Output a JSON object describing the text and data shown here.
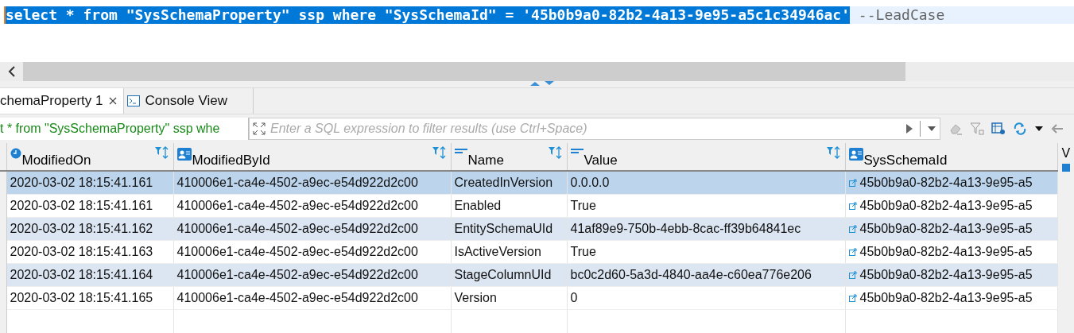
{
  "editor": {
    "segments": [
      {
        "kind": "code",
        "text": "select * from \"SysSchemaProperty\" ssp where \"SysSchemaId\" = '45b0b9a0-82b2-4a13-9e95-a5c1c34946ac'",
        "selected": true
      },
      {
        "kind": "comment",
        "text": " --LeadCase",
        "selected": false
      }
    ]
  },
  "tabs": [
    {
      "kind": "results",
      "label": "chemaProperty 1",
      "selected": true
    },
    {
      "kind": "console",
      "label": "Console View",
      "selected": false
    }
  ],
  "filter": {
    "query": "t * from \"SysSchemaProperty\" ssp whe",
    "placeholder": "Enter a SQL expression to filter results (use Ctrl+Space)"
  },
  "table": {
    "columns": [
      {
        "kind": "date",
        "label": "ModifiedOn"
      },
      {
        "kind": "ref",
        "label": "ModifiedById"
      },
      {
        "kind": "text",
        "label": "Name"
      },
      {
        "kind": "text",
        "label": "Value"
      },
      {
        "kind": "ref",
        "label": "SysSchemaId"
      }
    ],
    "rows": [
      {
        "selected": true,
        "cells": [
          "2020-03-02 18:15:41.161",
          "410006e1-ca4e-4502-a9ec-e54d922d2c00",
          "CreatedInVersion",
          "0.0.0.0",
          "45b0b9a0-82b2-4a13-9e95-a5"
        ]
      },
      {
        "selected": false,
        "cells": [
          "2020-03-02 18:15:41.161",
          "410006e1-ca4e-4502-a9ec-e54d922d2c00",
          "Enabled",
          "True",
          "45b0b9a0-82b2-4a13-9e95-a5"
        ]
      },
      {
        "selected": false,
        "cells": [
          "2020-03-02 18:15:41.162",
          "410006e1-ca4e-4502-a9ec-e54d922d2c00",
          "EntitySchemaUId",
          "41af89e9-750b-4ebb-8cac-ff39b64841ec",
          "45b0b9a0-82b2-4a13-9e95-a5"
        ]
      },
      {
        "selected": false,
        "cells": [
          "2020-03-02 18:15:41.163",
          "410006e1-ca4e-4502-a9ec-e54d922d2c00",
          "IsActiveVersion",
          "True",
          "45b0b9a0-82b2-4a13-9e95-a5"
        ]
      },
      {
        "selected": false,
        "cells": [
          "2020-03-02 18:15:41.164",
          "410006e1-ca4e-4502-a9ec-e54d922d2c00",
          "StageColumnUId",
          "bc0c2d60-5a3d-4840-aa4e-c60ea776e206",
          "45b0b9a0-82b2-4a13-9e95-a5"
        ]
      },
      {
        "selected": false,
        "cells": [
          "2020-03-02 18:15:41.165",
          "410006e1-ca4e-4502-a9ec-e54d922d2c00",
          "Version",
          "0",
          "45b0b9a0-82b2-4a13-9e95-a5"
        ]
      }
    ]
  },
  "side_panel": {
    "label": "V"
  }
}
